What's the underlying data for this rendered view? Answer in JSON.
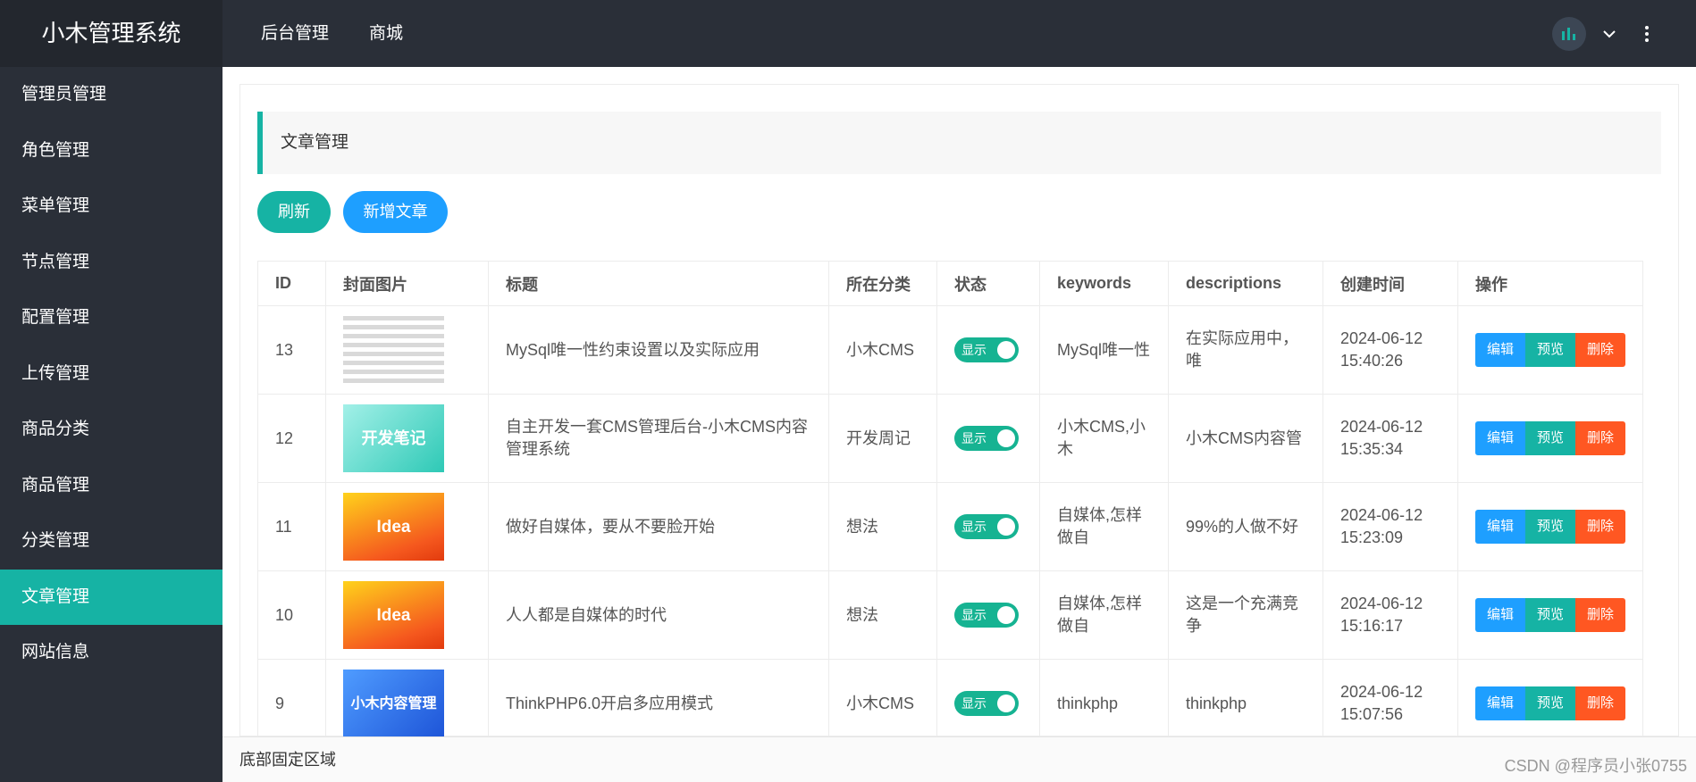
{
  "app_title": "小木管理系统",
  "top_nav": [
    "后台管理",
    "商城"
  ],
  "sidebar": {
    "items": [
      {
        "label": "管理员管理",
        "active": false
      },
      {
        "label": "角色管理",
        "active": false
      },
      {
        "label": "菜单管理",
        "active": false
      },
      {
        "label": "节点管理",
        "active": false
      },
      {
        "label": "配置管理",
        "active": false
      },
      {
        "label": "上传管理",
        "active": false
      },
      {
        "label": "商品分类",
        "active": false
      },
      {
        "label": "商品管理",
        "active": false
      },
      {
        "label": "分类管理",
        "active": false
      },
      {
        "label": "文章管理",
        "active": true
      },
      {
        "label": "网站信息",
        "active": false
      }
    ]
  },
  "main": {
    "section_title": "文章管理",
    "refresh_label": "刷新",
    "add_label": "新增文章",
    "table": {
      "headers": [
        "ID",
        "封面图片",
        "标题",
        "所在分类",
        "状态",
        "keywords",
        "descriptions",
        "创建时间",
        "操作"
      ],
      "rows": [
        {
          "id": "13",
          "cover": "",
          "title": "MySql唯一性约束设置以及实际应用",
          "category": "小木CMS",
          "status": "显示",
          "keywords": "MySql唯一性",
          "descriptions": "在实际应用中，唯",
          "created": "2024-06-12 15:40:26"
        },
        {
          "id": "12",
          "cover": "开发笔记",
          "title": "自主开发一套CMS管理后台-小木CMS内容管理系统",
          "category": "开发周记",
          "status": "显示",
          "keywords": "小木CMS,小木",
          "descriptions": "小木CMS内容管",
          "created": "2024-06-12 15:35:34"
        },
        {
          "id": "11",
          "cover": "Idea",
          "title": "做好自媒体，要从不要脸开始",
          "category": "想法",
          "status": "显示",
          "keywords": "自媒体,怎样做自",
          "descriptions": "99%的人做不好",
          "created": "2024-06-12 15:23:09"
        },
        {
          "id": "10",
          "cover": "Idea",
          "title": "人人都是自媒体的时代",
          "category": "想法",
          "status": "显示",
          "keywords": "自媒体,怎样做自",
          "descriptions": "这是一个充满竞争",
          "created": "2024-06-12 15:16:17"
        },
        {
          "id": "9",
          "cover": "小木内容管理",
          "title": "ThinkPHP6.0开启多应用模式",
          "category": "小木CMS",
          "status": "显示",
          "keywords": "thinkphp",
          "descriptions": "thinkphp",
          "created": "2024-06-12 15:07:56"
        }
      ],
      "ops": {
        "edit": "编辑",
        "preview": "预览",
        "delete": "删除"
      }
    }
  },
  "footer_text": "底部固定区域",
  "watermark": "CSDN @程序员小张0755",
  "colors": {
    "accent": "#16b3a4",
    "primary": "#1e9fff",
    "danger": "#ff5722",
    "sidebar_bg": "#2a2f38"
  }
}
